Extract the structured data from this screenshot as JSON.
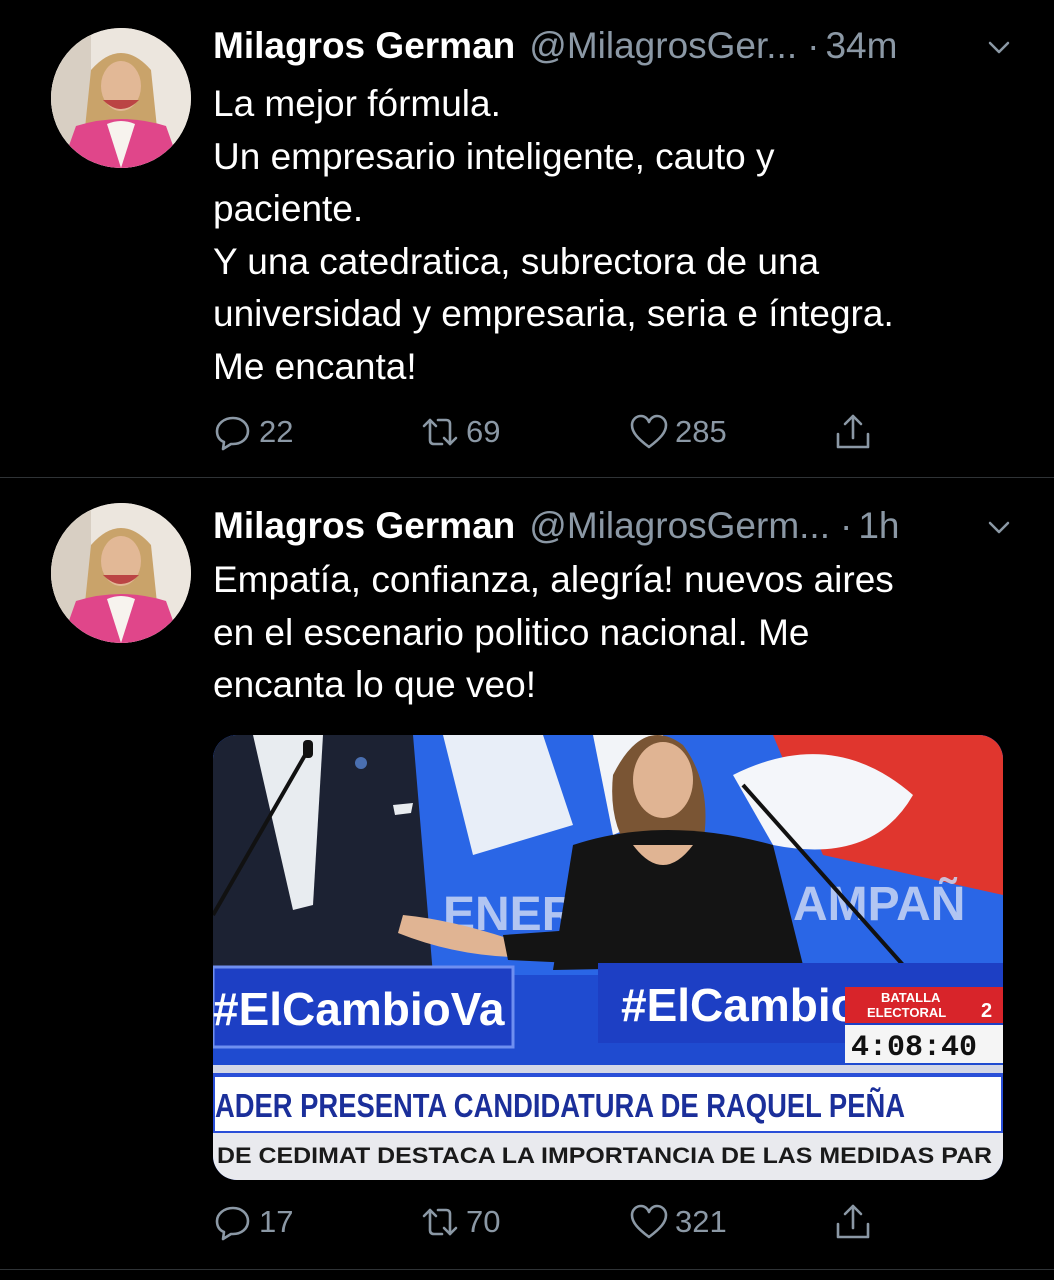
{
  "tweets": [
    {
      "name": "Milagros German",
      "handle": "@MilagrosGer...",
      "separator": "·",
      "time": "34m",
      "lines": [
        "La mejor fórmula.",
        "Un empresario inteligente, cauto y",
        "paciente.",
        "Y una catedratica, subrectora de una",
        "universidad y empresaria, seria e íntegra.",
        "Me encanta!"
      ],
      "replies": "22",
      "retweets": "69",
      "likes": "285"
    },
    {
      "name": "Milagros German",
      "handle": "@MilagrosGerm...",
      "separator": "·",
      "time": "1h",
      "lines": [
        "Empatía, confianza, alegría! nuevos aires",
        "en el escenario politico nacional. Me",
        "encanta lo que veo!"
      ],
      "replies": "17",
      "retweets": "70",
      "likes": "321",
      "media": {
        "backdrop_left": "ENER",
        "backdrop_right": "AMPAÑ",
        "podium_left": "#ElCambioVa",
        "podium_right": "#ElCambio",
        "badge_line1": "BATALLA",
        "badge_line2": "ELECTORAL",
        "badge_num": "2",
        "clock": "4:08:40",
        "headline": "ADER PRESENTA CANDIDATURA DE RAQUEL PEÑA",
        "ticker": "DE CEDIMAT DESTACA LA IMPORTANCIA DE LAS MEDIDAS PAR"
      }
    }
  ],
  "colors": {
    "background": "#000000",
    "muted": "#8b98a5",
    "divider": "#2f3336",
    "tv_blue": "#1a3fbd"
  }
}
